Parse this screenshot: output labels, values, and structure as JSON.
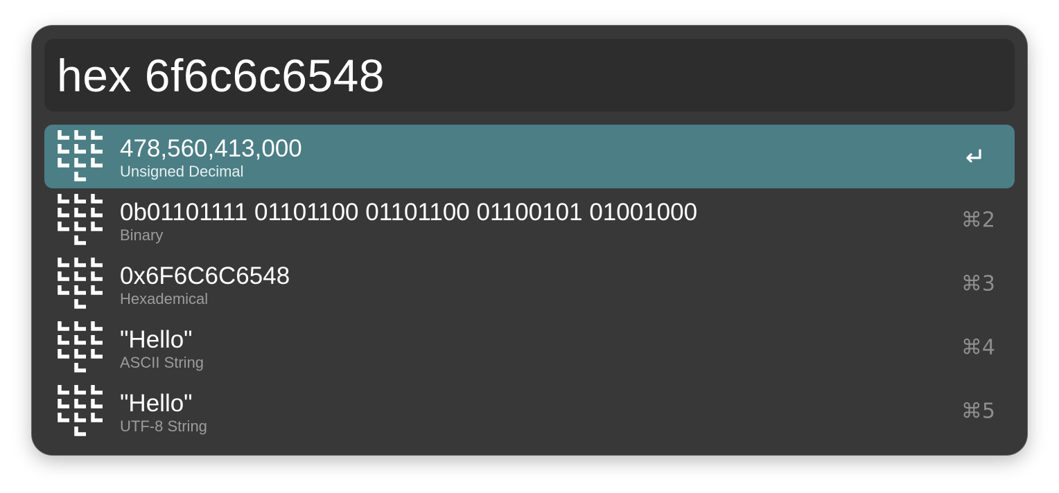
{
  "search": {
    "query": "hex 6f6c6c6548"
  },
  "results": [
    {
      "title": "478,560,413,000",
      "subtitle": "Unsigned Decimal",
      "shortcut": "",
      "icon": "calculator-grid-icon",
      "selected": true
    },
    {
      "title": "0b01101111 01101100 01101100 01100101 01001000",
      "subtitle": "Binary",
      "shortcut": "⌘2",
      "icon": "calculator-grid-icon",
      "selected": false
    },
    {
      "title": "0x6F6C6C6548",
      "subtitle": "Hexademical",
      "shortcut": "⌘3",
      "icon": "calculator-grid-icon",
      "selected": false
    },
    {
      "title": "\"Hello\"",
      "subtitle": "ASCII String",
      "shortcut": "⌘4",
      "icon": "calculator-grid-icon",
      "selected": false
    },
    {
      "title": "\"Hello\"",
      "subtitle": "UTF-8 String",
      "shortcut": "⌘5",
      "icon": "calculator-grid-icon",
      "selected": false
    }
  ],
  "colors": {
    "window_bg": "#383838",
    "query_bg": "#2d2d2d",
    "selected_bg": "#4c7e85",
    "subtitle_text": "#9c9c9c",
    "shortcut_text": "#8e8e8e"
  }
}
